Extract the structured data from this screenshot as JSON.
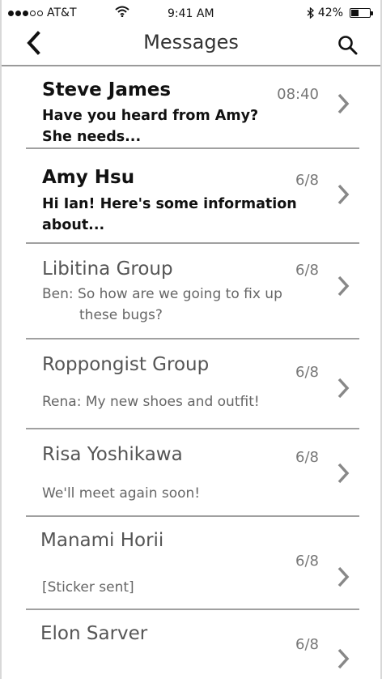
{
  "status_bar": {
    "carrier": "AT&T",
    "time": "9:41 AM",
    "battery": "42%",
    "battery_level": 0.42,
    "signal_bars": 3,
    "signal_total": 5
  },
  "header": {
    "title": "Messages",
    "back_icon": "chevron-left-icon",
    "search_icon": "search-icon"
  },
  "conversations": [
    {
      "name": "Steve James",
      "date": "08:40",
      "preview_line1": "Have you heard from Amy?",
      "preview_line2": "She needs...",
      "unread": true
    },
    {
      "name": "Amy Hsu",
      "date": "6/8",
      "preview_line1": "Hi Ian! Here's some information",
      "preview_line2": "about...",
      "unread": true
    },
    {
      "name": "Libitina Group",
      "date": "6/8",
      "preview_line1": "Ben: So how are we going to fix up",
      "preview_line2": "these bugs?",
      "unread": false
    },
    {
      "name": "Roppongist Group",
      "date": "6/8",
      "preview_line1": "Rena: My new shoes and outfit!",
      "preview_line2": "",
      "unread": false
    },
    {
      "name": "Risa Yoshikawa",
      "date": "6/8",
      "preview_line1": "We'll meet again soon!",
      "preview_line2": "",
      "unread": false
    },
    {
      "name": "Manami Horii",
      "date": "6/8",
      "preview_line1": "[Sticker sent]",
      "preview_line2": "",
      "unread": false
    },
    {
      "name": "Elon Sarver",
      "date": "6/8",
      "preview_line1": "",
      "preview_line2": "",
      "unread": false
    }
  ],
  "colors": {
    "divider": "#a0a0a0",
    "chevron": "#888888",
    "text_dark": "#111111",
    "text_muted": "#666666"
  }
}
